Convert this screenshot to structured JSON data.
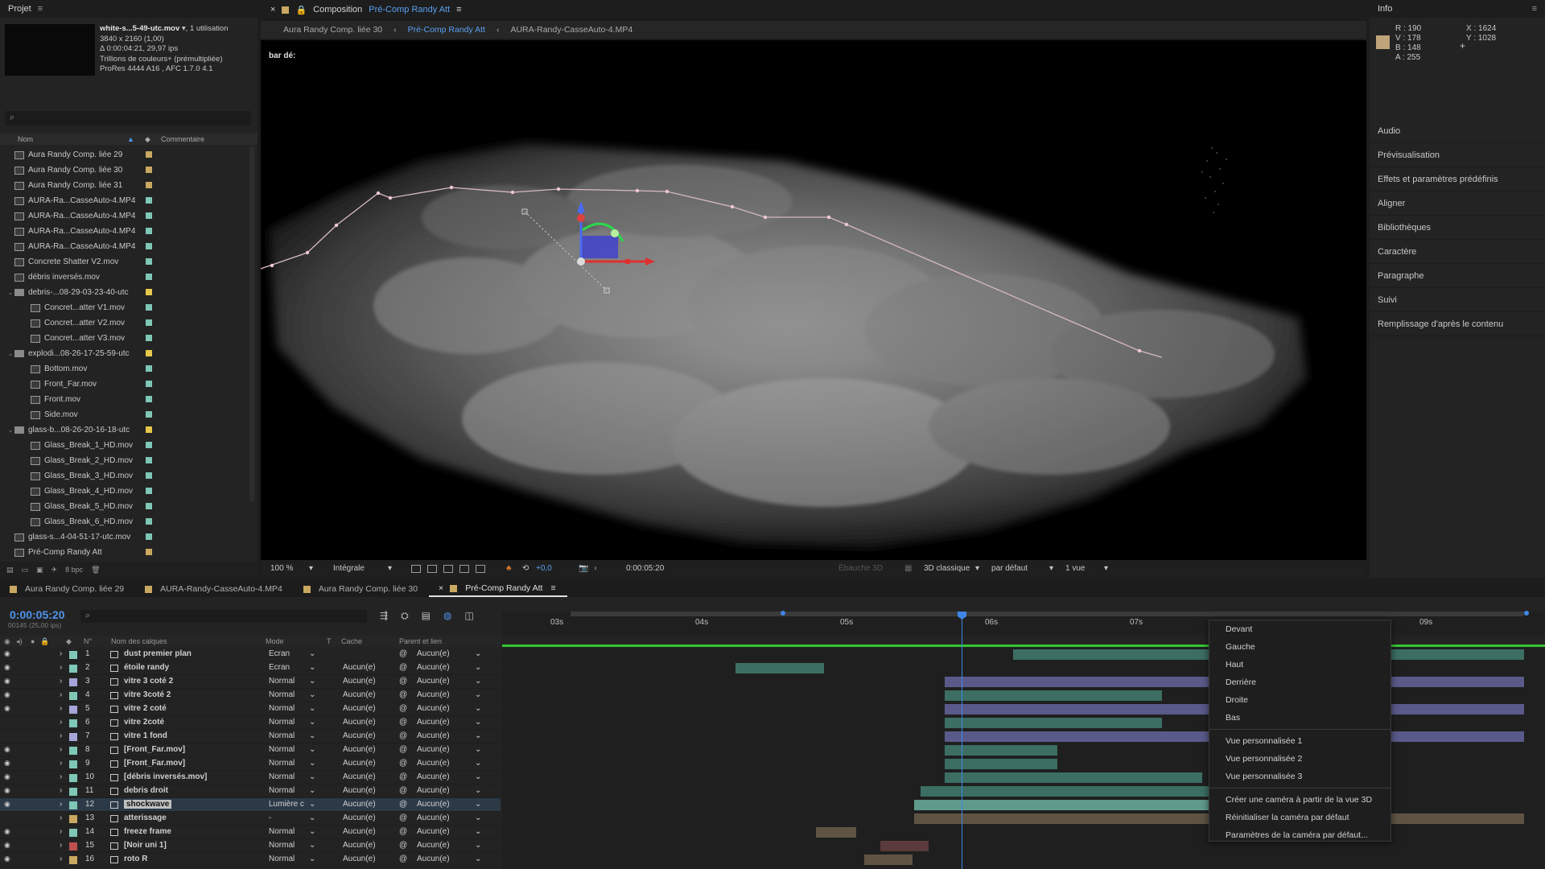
{
  "project": {
    "title": "Projet",
    "file": {
      "name": "white-s...5-49-utc.mov",
      "usage": ", 1 utilisation",
      "resolution": "3840 x 2160 (1,00)",
      "duration": "Δ 0:00:04:21, 29,97 ips",
      "color": "Trillions de couleurs+ (prémultipliée)",
      "codec": "ProRes 4444 A16 , AFC 1.7.0 4.1"
    },
    "columns": {
      "name": "Nom",
      "comment": "Commentaire"
    },
    "items": [
      {
        "label": "Aura Randy Comp. liée 29",
        "indent": 0,
        "type": "comp",
        "color": "#c9a861"
      },
      {
        "label": "Aura Randy Comp. liée 30",
        "indent": 0,
        "type": "comp",
        "color": "#c9a861"
      },
      {
        "label": "Aura Randy Comp. liée 31",
        "indent": 0,
        "type": "comp",
        "color": "#c9a861"
      },
      {
        "label": "AURA-Ra...CasseAuto-4.MP4",
        "indent": 0,
        "type": "file",
        "color": "#7fc7b6"
      },
      {
        "label": "AURA-Ra...CasseAuto-4.MP4",
        "indent": 0,
        "type": "file",
        "color": "#7fc7b6"
      },
      {
        "label": "AURA-Ra...CasseAuto-4.MP4",
        "indent": 0,
        "type": "file",
        "color": "#7fc7b6"
      },
      {
        "label": "AURA-Ra...CasseAuto-4.MP4",
        "indent": 0,
        "type": "file",
        "color": "#7fc7b6"
      },
      {
        "label": "Concrete Shatter V2.mov",
        "indent": 0,
        "type": "file",
        "color": "#7fc7b6"
      },
      {
        "label": "débris inversés.mov",
        "indent": 0,
        "type": "file",
        "color": "#7fc7b6"
      },
      {
        "label": "debris-...08-29-03-23-40-utc",
        "indent": 0,
        "type": "folder",
        "color": "#e6c84a"
      },
      {
        "label": "Concret...atter V1.mov",
        "indent": 1,
        "type": "file",
        "color": "#7fc7b6"
      },
      {
        "label": "Concret...atter V2.mov",
        "indent": 1,
        "type": "file",
        "color": "#7fc7b6"
      },
      {
        "label": "Concret...atter V3.mov",
        "indent": 1,
        "type": "file",
        "color": "#7fc7b6"
      },
      {
        "label": "explodi...08-26-17-25-59-utc",
        "indent": 0,
        "type": "folder",
        "color": "#e6c84a"
      },
      {
        "label": "Bottom.mov",
        "indent": 1,
        "type": "file",
        "color": "#7fc7b6"
      },
      {
        "label": "Front_Far.mov",
        "indent": 1,
        "type": "file",
        "color": "#7fc7b6"
      },
      {
        "label": "Front.mov",
        "indent": 1,
        "type": "file",
        "color": "#7fc7b6"
      },
      {
        "label": "Side.mov",
        "indent": 1,
        "type": "file",
        "color": "#7fc7b6"
      },
      {
        "label": "glass-b...08-26-20-16-18-utc",
        "indent": 0,
        "type": "folder",
        "color": "#e6c84a"
      },
      {
        "label": "Glass_Break_1_HD.mov",
        "indent": 1,
        "type": "file",
        "color": "#7fc7b6"
      },
      {
        "label": "Glass_Break_2_HD.mov",
        "indent": 1,
        "type": "file",
        "color": "#7fc7b6"
      },
      {
        "label": "Glass_Break_3_HD.mov",
        "indent": 1,
        "type": "file",
        "color": "#7fc7b6"
      },
      {
        "label": "Glass_Break_4_HD.mov",
        "indent": 1,
        "type": "file",
        "color": "#7fc7b6"
      },
      {
        "label": "Glass_Break_5_HD.mov",
        "indent": 1,
        "type": "file",
        "color": "#7fc7b6"
      },
      {
        "label": "Glass_Break_6_HD.mov",
        "indent": 1,
        "type": "file",
        "color": "#7fc7b6"
      },
      {
        "label": "glass-s...4-04-51-17-utc.mov",
        "indent": 0,
        "type": "file",
        "color": "#7fc7b6"
      },
      {
        "label": "Pré-Comp Randy Att",
        "indent": 0,
        "type": "comp",
        "color": "#c9a861"
      }
    ],
    "bpc": "8 bpc"
  },
  "composition": {
    "label": "Composition",
    "name": "Pré-Comp Randy Att",
    "breadcrumbs": [
      "Aura Randy Comp. liée 30",
      "Pré-Comp Randy Att",
      "AURA-Randy-CasseAuto-4.MP4"
    ],
    "viewer_label": "bar dé:",
    "zoom": "100 %",
    "resolution": "Intégrale",
    "exposure": "+0,0",
    "timecode": "0:00:05:20",
    "draft3d": "Ébauche 3D",
    "renderer": "3D classique",
    "camera": "par défaut",
    "views": "1 vue"
  },
  "info": {
    "title": "Info",
    "r": "R : 190",
    "v": "V : 178",
    "b": "B : 148",
    "a": "A : 255",
    "x": "X : 1624",
    "y": "Y : 1028",
    "swatch_color": "#bea478",
    "panels": [
      "Audio",
      "Prévisualisation",
      "Effets et paramètres prédéfinis",
      "Aligner",
      "Bibliothèques",
      "Caractère",
      "Paragraphe",
      "Suivi",
      "Remplissage d'après le contenu"
    ]
  },
  "timeline": {
    "tabs": [
      {
        "label": "Aura Randy Comp. liée 29",
        "color": "#c9a861",
        "active": false
      },
      {
        "label": "AURA-Randy-CasseAuto-4.MP4",
        "color": "#c9a861",
        "active": false
      },
      {
        "label": "Aura Randy Comp. liée 30",
        "color": "#c9a861",
        "active": false
      },
      {
        "label": "Pré-Comp Randy Att",
        "color": "#c9a861",
        "active": true
      }
    ],
    "timecode": "0:00:05:20",
    "fps": "00145 (25,00 ips)",
    "columns": {
      "num": "N°",
      "name": "Nom des calques",
      "mode": "Mode",
      "t": "T",
      "cache": "Cache",
      "parent": "Parent et lien"
    },
    "ruler": [
      "03s",
      "04s",
      "05s",
      "06s",
      "07s",
      "09s"
    ],
    "layers": [
      {
        "num": "1",
        "name": "dust premier plan",
        "mode": "Ecran",
        "cache": "",
        "parent": "Aucun(e)",
        "color": "#7fc7b6",
        "eye": true
      },
      {
        "num": "2",
        "name": "étoile randy",
        "mode": "Ecran",
        "cache": "Aucun(e)",
        "parent": "Aucun(e)",
        "color": "#7fc7b6",
        "eye": true
      },
      {
        "num": "3",
        "name": "vitre 3 coté 2",
        "mode": "Normal",
        "cache": "Aucun(e)",
        "parent": "Aucun(e)",
        "color": "#a6a6d8",
        "eye": true
      },
      {
        "num": "4",
        "name": "vitre 3coté 2",
        "mode": "Normal",
        "cache": "Aucun(e)",
        "parent": "Aucun(e)",
        "color": "#7fc7b6",
        "eye": true
      },
      {
        "num": "5",
        "name": "vitre 2 coté",
        "mode": "Normal",
        "cache": "Aucun(e)",
        "parent": "Aucun(e)",
        "color": "#a6a6d8",
        "eye": true
      },
      {
        "num": "6",
        "name": "vitre 2coté",
        "mode": "Normal",
        "cache": "Aucun(e)",
        "parent": "Aucun(e)",
        "color": "#7fc7b6",
        "eye": false
      },
      {
        "num": "7",
        "name": "vitre 1 fond",
        "mode": "Normal",
        "cache": "Aucun(e)",
        "parent": "Aucun(e)",
        "color": "#a6a6d8",
        "eye": false
      },
      {
        "num": "8",
        "name": "[Front_Far.mov]",
        "mode": "Normal",
        "cache": "Aucun(e)",
        "parent": "Aucun(e)",
        "color": "#7fc7b6",
        "eye": true
      },
      {
        "num": "9",
        "name": "[Front_Far.mov]",
        "mode": "Normal",
        "cache": "Aucun(e)",
        "parent": "Aucun(e)",
        "color": "#7fc7b6",
        "eye": true
      },
      {
        "num": "10",
        "name": "[débris inversés.mov]",
        "mode": "Normal",
        "cache": "Aucun(e)",
        "parent": "Aucun(e)",
        "color": "#7fc7b6",
        "eye": true
      },
      {
        "num": "11",
        "name": "debris droit",
        "mode": "Normal",
        "cache": "Aucun(e)",
        "parent": "Aucun(e)",
        "color": "#7fc7b6",
        "eye": true
      },
      {
        "num": "12",
        "name": "shockwave",
        "mode": "Lumière c",
        "cache": "Aucun(e)",
        "parent": "Aucun(e)",
        "color": "#7fc7b6",
        "eye": true,
        "selected": true
      },
      {
        "num": "13",
        "name": "atterissage",
        "mode": "-",
        "cache": "Aucun(e)",
        "parent": "Aucun(e)",
        "color": "#c9a861",
        "eye": false
      },
      {
        "num": "14",
        "name": "freeze frame",
        "mode": "Normal",
        "cache": "Aucun(e)",
        "parent": "Aucun(e)",
        "color": "#7fc7b6",
        "eye": true
      },
      {
        "num": "15",
        "name": "[Noir uni 1]",
        "mode": "Normal",
        "cache": "Aucun(e)",
        "parent": "Aucun(e)",
        "color": "#c05050",
        "eye": true
      },
      {
        "num": "16",
        "name": "roto R",
        "mode": "Normal",
        "cache": "Aucun(e)",
        "parent": "Aucun(e)",
        "color": "#c9a861",
        "eye": true
      }
    ]
  },
  "context_menu": {
    "items": [
      "Devant",
      "Gauche",
      "Haut",
      "Derrière",
      "Droite",
      "Bas"
    ],
    "custom": [
      "Vue personnalisée 1",
      "Vue personnalisée 2",
      "Vue personnalisée 3"
    ],
    "actions": [
      "Créer une caméra à partir de la vue 3D",
      "Réinitialiser la caméra par défaut",
      "Paramètres de la caméra par défaut..."
    ]
  }
}
